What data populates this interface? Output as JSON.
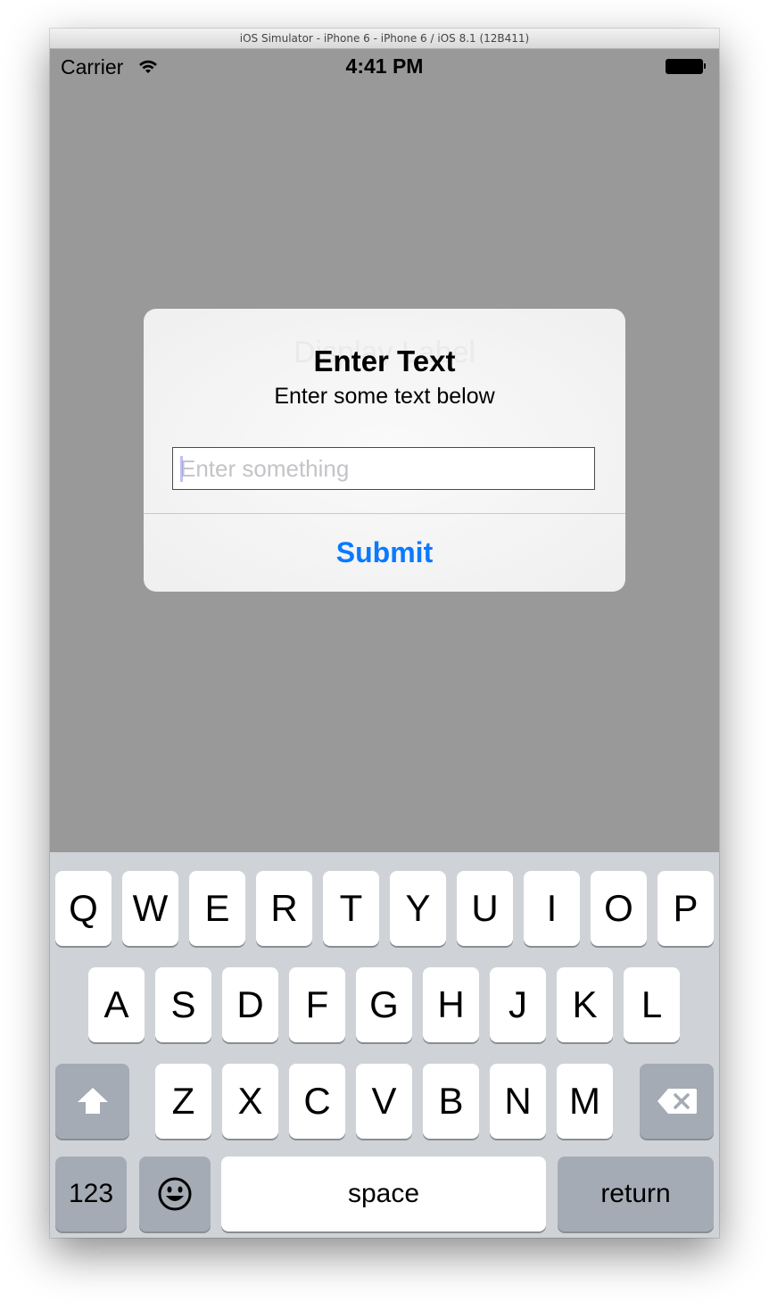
{
  "window": {
    "title": "iOS Simulator - iPhone 6 - iPhone 6 / iOS 8.1 (12B411)"
  },
  "status_bar": {
    "carrier": "Carrier",
    "time": "4:41 PM",
    "icons": [
      "wifi-icon",
      "battery-icon"
    ]
  },
  "background": {
    "ghost_label": "Display Label"
  },
  "alert": {
    "title": "Enter Text",
    "message": "Enter some text below",
    "input_value": "",
    "input_placeholder": "Enter something",
    "button_label": "Submit",
    "button_color": "#0a7aff"
  },
  "keyboard": {
    "rows": [
      [
        "Q",
        "W",
        "E",
        "R",
        "T",
        "Y",
        "U",
        "I",
        "O",
        "P"
      ],
      [
        "A",
        "S",
        "D",
        "F",
        "G",
        "H",
        "J",
        "K",
        "L"
      ],
      [
        "Z",
        "X",
        "C",
        "V",
        "B",
        "N",
        "M"
      ]
    ],
    "shift_icon": "shift-arrow-icon",
    "delete_icon": "backspace-icon",
    "numbers_label": "123",
    "emoji_icon": "emoji-smiley-icon",
    "space_label": "space",
    "return_label": "return"
  },
  "colors": {
    "dimmed_background": "#999999",
    "keyboard_background": "#cfd3d8",
    "accent": "#0a7aff"
  }
}
